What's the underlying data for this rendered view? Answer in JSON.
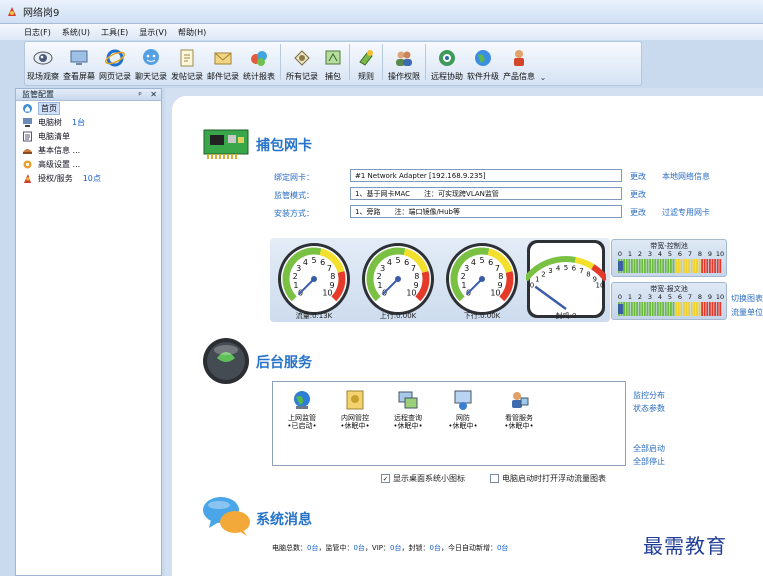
{
  "window": {
    "title": "网络岗9"
  },
  "menu": [
    "日志(F)",
    "系统(U)",
    "工具(E)",
    "显示(V)",
    "帮助(H)"
  ],
  "toolbar": {
    "items": [
      {
        "label": "现场观察",
        "icon": "eye-icon"
      },
      {
        "label": "查看屏幕",
        "icon": "monitor-icon"
      },
      {
        "label": "网页记录",
        "icon": "ie-icon"
      },
      {
        "label": "聊天记录",
        "icon": "chat-icon"
      },
      {
        "label": "发帖记录",
        "icon": "post-icon"
      },
      {
        "label": "邮件记录",
        "icon": "mail-icon"
      },
      {
        "label": "统计报表",
        "icon": "chart-icon"
      },
      {
        "label": "所有记录",
        "icon": "records-icon"
      },
      {
        "label": "捕包",
        "icon": "capture-icon"
      },
      {
        "label": "规则",
        "icon": "rules-icon"
      },
      {
        "label": "操作权限",
        "icon": "users-icon"
      },
      {
        "label": "远程协助",
        "icon": "remote-icon"
      },
      {
        "label": "软件升级",
        "icon": "globe-icon"
      },
      {
        "label": "产品信息",
        "icon": "info-icon"
      }
    ],
    "overflow": "⌄"
  },
  "panel": {
    "title": "监管配置",
    "pin": "ᵖ",
    "close": "✕",
    "items": [
      {
        "label": "首页",
        "count": "",
        "icon": "home-icon",
        "selected": true
      },
      {
        "label": "电脑树",
        "count": "1台",
        "icon": "tree-icon"
      },
      {
        "label": "电脑清单",
        "count": "",
        "icon": "list-icon"
      },
      {
        "label": "基本信息 ...",
        "count": "",
        "icon": "basic-info-icon"
      },
      {
        "label": "高级设置 ...",
        "count": "",
        "icon": "advanced-icon"
      },
      {
        "label": "授权/服务",
        "count": "10点",
        "icon": "license-icon"
      }
    ]
  },
  "capture": {
    "title": "捕包网卡",
    "fields": [
      {
        "label": "绑定网卡：",
        "value": "#1 Network Adapter [192.168.9.235]",
        "action": "更改",
        "extra": "本地网络信息"
      },
      {
        "label": "监管模式：",
        "value": "1、基于网卡MAC　　注：可实现跨VLAN监管",
        "action": "更改",
        "extra": ""
      },
      {
        "label": "安装方式：",
        "value": "1、旁路　　注：端口镜像/Hub等",
        "action": "更改",
        "extra": "过滤专用网卡"
      }
    ],
    "gauges": [
      {
        "caption": "流量:0.13K",
        "value": 0
      },
      {
        "caption": "上行:0.00K",
        "value": 0
      },
      {
        "caption": "下行:0.00K",
        "value": 0
      }
    ],
    "block_gauge": {
      "caption": "封鸡:0",
      "value": 0
    },
    "bars": [
      {
        "title": "带宽-控制池",
        "ticks": [
          "0",
          "1",
          "2",
          "3",
          "4",
          "5",
          "6",
          "7",
          "8",
          "9",
          "10"
        ],
        "level": 0.05
      },
      {
        "title": "带宽-报文池",
        "ticks": [
          "0",
          "1",
          "2",
          "3",
          "4",
          "5",
          "6",
          "7",
          "8",
          "9",
          "10"
        ],
        "level": 0.05
      }
    ],
    "bar_links": [
      "切换图表",
      "流量单位"
    ]
  },
  "service": {
    "title": "后台服务",
    "items": [
      {
        "line1": "上网监管",
        "line2": "•已启动•",
        "icon": "internet-monitor-icon"
      },
      {
        "line1": "内网管控",
        "line2": "•休眠中•",
        "icon": "lan-control-icon"
      },
      {
        "line1": "远程查询",
        "line2": "•休眠中•",
        "icon": "remote-query-icon"
      },
      {
        "line1": "网防",
        "line2": "•休眠中•",
        "icon": "net-guard-icon"
      },
      {
        "line1": "看管服务",
        "line2": "•休眠中•",
        "icon": "watch-service-icon"
      }
    ],
    "links_top": [
      "监控分布",
      "状态参数"
    ],
    "links_bottom": [
      "全部启动",
      "全部停止"
    ],
    "checkbox1": {
      "label": "显示桌面系统小图标",
      "checked": true
    },
    "checkbox2": {
      "label": "电脑启动时打开浮动流量图表",
      "checked": false
    }
  },
  "messages": {
    "title": "系统消息",
    "stats": [
      {
        "label": "电脑总数：",
        "value": "0台"
      },
      {
        "label": "，监管中：",
        "value": "0台"
      },
      {
        "label": "，VIP：",
        "value": "0台"
      },
      {
        "label": "，封锁：",
        "value": "0台"
      },
      {
        "label": "，今日自动新增：",
        "value": "0台"
      }
    ]
  },
  "watermark": "最需教育",
  "colors": {
    "accent": "#2673c9",
    "link": "#2a6cc4",
    "background": "#c9d9ee"
  }
}
